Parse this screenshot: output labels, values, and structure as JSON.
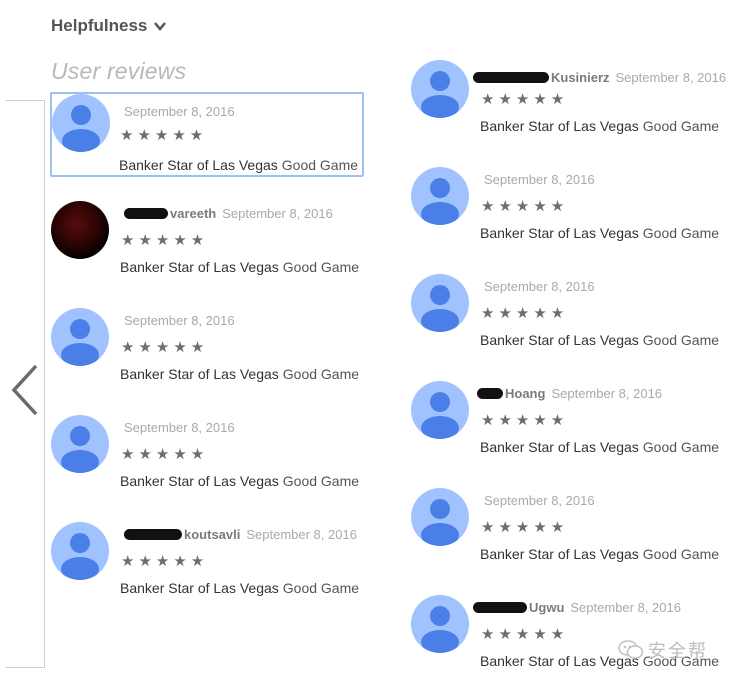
{
  "sort": {
    "label": "Helpfulness"
  },
  "section": {
    "title": "User reviews"
  },
  "reviews": [
    {
      "author": "",
      "date": "September 8, 2016",
      "stars": "★★★★★",
      "game": "Banker Star of Las Vegas",
      "verdict": "Good Game"
    },
    {
      "author": "vareeth",
      "date": "September 8, 2016",
      "stars": "★★★★★",
      "game": "Banker Star of Las Vegas",
      "verdict": "Good Game"
    },
    {
      "author": "",
      "date": "September 8, 2016",
      "stars": "★★★★★",
      "game": "Banker Star of Las Vegas",
      "verdict": "Good Game"
    },
    {
      "author": "",
      "date": "September 8, 2016",
      "stars": "★★★★★",
      "game": "Banker Star of Las Vegas",
      "verdict": "Good Game"
    },
    {
      "author": "koutsavli",
      "date": "September 8, 2016",
      "stars": "★★★★★",
      "game": "Banker Star of Las Vegas",
      "verdict": "Good Game"
    },
    {
      "author": "Kusinierz",
      "date": "September 8, 2016",
      "stars": "★★★★★",
      "game": "Banker Star of Las Vegas",
      "verdict": "Good Game"
    },
    {
      "author": "",
      "date": "September 8, 2016",
      "stars": "★★★★★",
      "game": "Banker Star of Las Vegas",
      "verdict": "Good Game"
    },
    {
      "author": "",
      "date": "September 8, 2016",
      "stars": "★★★★★",
      "game": "Banker Star of Las Vegas",
      "verdict": "Good Game"
    },
    {
      "author": "Hoang",
      "date": "September 8, 2016",
      "stars": "★★★★★",
      "game": "Banker Star of Las Vegas",
      "verdict": "Good Game"
    },
    {
      "author": "",
      "date": "September 8, 2016",
      "stars": "★★★★★",
      "game": "Banker Star of Las Vegas",
      "verdict": "Good Game"
    },
    {
      "author": "Ugwu",
      "date": "September 8, 2016",
      "stars": "★★★★★",
      "game": "Banker Star of Las Vegas",
      "verdict": "Good Game"
    }
  ],
  "watermark": {
    "text": "安全帮"
  },
  "icons": {
    "sort": "chevron-down-icon",
    "nav": "chevron-left-icon",
    "avatar": "default-avatar-icon",
    "watermark": "wechat-icon"
  },
  "colors": {
    "avatar_bg": "#a0c3ff",
    "avatar_fg": "#4a7fe8",
    "highlight_border": "#9fbff0",
    "stars": "#6e6e6e"
  }
}
